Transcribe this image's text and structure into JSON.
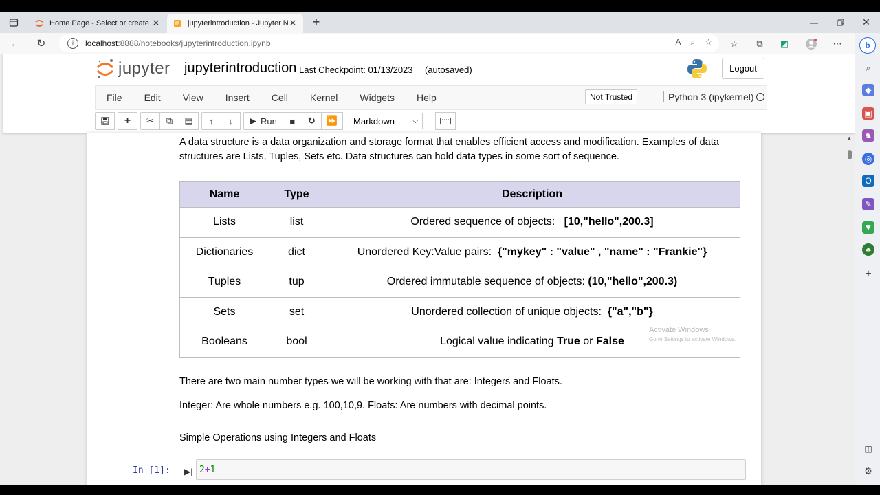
{
  "browser": {
    "tabs": [
      {
        "title": "Home Page - Select or create a n",
        "active": false
      },
      {
        "title": "jupyterintroduction - Jupyter No",
        "active": true
      }
    ],
    "new_tab": "+",
    "url_host": "localhost",
    "url_path": ":8888/notebooks/jupyterintroduction.ipynb"
  },
  "jupyter": {
    "logo_text": "jupyter",
    "notebook_name": "jupyterintroduction",
    "checkpoint": "Last Checkpoint: 01/13/2023",
    "autosaved": "(autosaved)",
    "logout": "Logout",
    "menu": [
      "File",
      "Edit",
      "View",
      "Insert",
      "Cell",
      "Kernel",
      "Widgets",
      "Help"
    ],
    "trust": "Not Trusted",
    "kernel": "Python 3 (ipykernel)",
    "toolbar": {
      "run_label": "Run",
      "cell_type": "Markdown"
    }
  },
  "notebook": {
    "intro_line1": "A data structure is a data organization and storage format that enables efficient access and modification. Examples of data",
    "intro_line2": "structures are Lists, Tuples, Sets etc. Data structures can hold data types in some sort of sequence.",
    "table": {
      "headers": [
        "Name",
        "Type",
        "Description"
      ],
      "rows": [
        {
          "name": "Lists",
          "type": "list",
          "desc": "Ordered sequence of objects:",
          "example": "[10,\"hello\",200.3]"
        },
        {
          "name": "Dictionaries",
          "type": "dict",
          "desc": "Unordered Key:Value pairs:",
          "example": "{\"mykey\" : \"value\" , \"name\" : \"Frankie\"}"
        },
        {
          "name": "Tuples",
          "type": "tup",
          "desc": "Ordered immutable sequence of objects:",
          "example": "(10,\"hello\",200.3)"
        },
        {
          "name": "Sets",
          "type": "set",
          "desc": "Unordered collection of unique objects:",
          "example": "{\"a\",\"b\"}"
        },
        {
          "name": "Booleans",
          "type": "bool",
          "desc": "Logical value indicating",
          "example_true": "True",
          "or": "or",
          "example_false": "False"
        }
      ]
    },
    "watermark_title": "Activate Windows",
    "watermark_sub": "Go to Settings to activate Windows.",
    "para1": "There are two main number types we will be working with that are: Integers and Floats.",
    "para2": "Integer: Are whole numbers e.g. 100,10,9. Floats: Are numbers with decimal points.",
    "heading": "Simple Operations using Integers and Floats",
    "cell_prompt": "In [1]:",
    "code": {
      "a": "2",
      "op": "+",
      "b": "1"
    }
  }
}
